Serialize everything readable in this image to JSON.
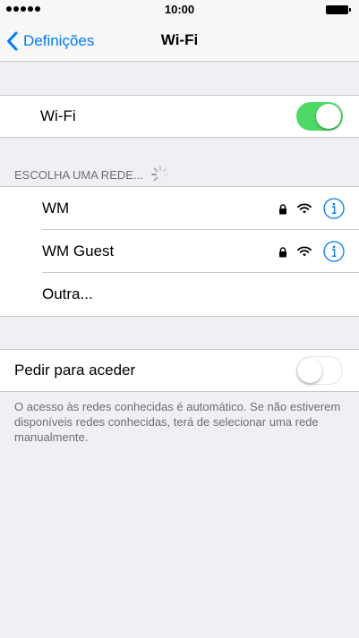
{
  "status_bar": {
    "time": "10:00"
  },
  "nav": {
    "back_label": "Definições",
    "title": "Wi-Fi"
  },
  "wifi": {
    "label": "Wi-Fi",
    "enabled": true
  },
  "networks": {
    "section_header": "ESCOLHA UMA REDE...",
    "items": [
      {
        "name": "WM",
        "secured": true
      },
      {
        "name": "WM Guest",
        "secured": true
      },
      {
        "name": "Outra..."
      }
    ]
  },
  "ask_to_join": {
    "label": "Pedir para aceder",
    "enabled": false,
    "footer": "O acesso às redes conhecidas é automático. Se não estiverem disponíveis redes conhecidas, terá de selecionar uma rede manualmente."
  },
  "colors": {
    "accent": "#007aff",
    "toggle_on": "#4cd964",
    "background": "#efeff4"
  }
}
